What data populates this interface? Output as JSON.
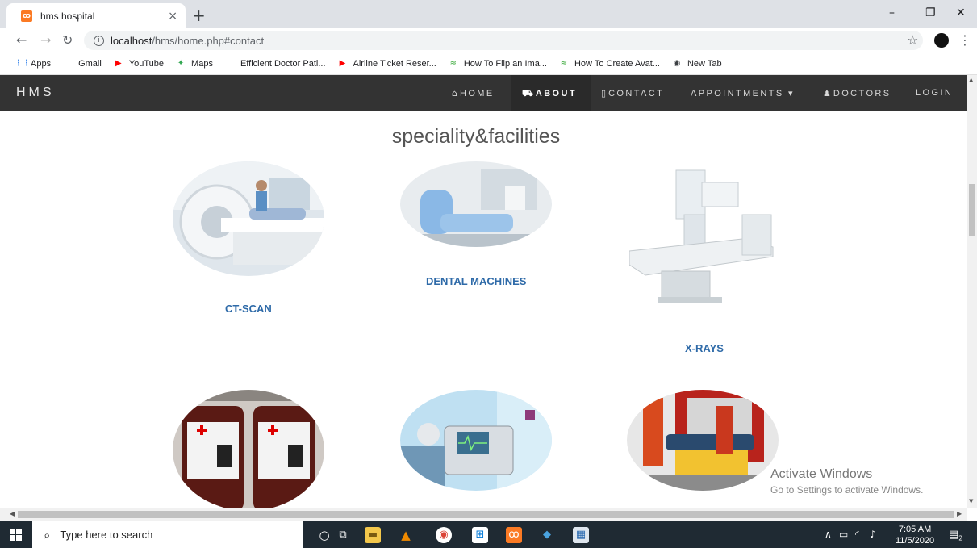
{
  "browser": {
    "tab_title": "hms hospital",
    "tab_close": "×",
    "new_tab": "+",
    "window_controls": {
      "minimize": "–",
      "maximize": "❐",
      "close": "✕"
    },
    "url_host": "localhost",
    "url_path": "/hms/home.php#contact",
    "bookmarks": [
      {
        "label": "Apps",
        "icon": "apps-grid-icon",
        "color": "#1a73e8",
        "glyph": "⋮⋮"
      },
      {
        "label": "Gmail",
        "icon": "gmail-icon",
        "color": "#ffffff",
        "glyph": "M"
      },
      {
        "label": "YouTube",
        "icon": "youtube-icon",
        "color": "#ff0000",
        "glyph": "▶"
      },
      {
        "label": "Maps",
        "icon": "maps-icon",
        "color": "#34a853",
        "glyph": "✦"
      },
      {
        "label": "Efficient Doctor Pati...",
        "icon": "sketch-icon",
        "color": "#ffffff",
        "glyph": "𝓋"
      },
      {
        "label": "Airline Ticket Reser...",
        "icon": "youtube-icon",
        "color": "#ff0000",
        "glyph": "▶"
      },
      {
        "label": "How To Flip an Ima...",
        "icon": "site-icon",
        "color": "#5cb85c",
        "glyph": "≈"
      },
      {
        "label": "How To Create Avat...",
        "icon": "site-icon",
        "color": "#5cb85c",
        "glyph": "≈"
      },
      {
        "label": "New Tab",
        "icon": "globe-icon",
        "color": "#3c4043",
        "glyph": "◉"
      }
    ]
  },
  "site": {
    "brand": "HMS",
    "nav": [
      {
        "label": "HOME",
        "glyph": "⌂",
        "icon": "home-icon"
      },
      {
        "label": "ABOUT",
        "glyph": "⛟",
        "icon": "cart-icon"
      },
      {
        "label": "CONTACT",
        "glyph": "▯",
        "icon": "phone-icon"
      },
      {
        "label": "APPOINTMENTS ▾",
        "glyph": "",
        "icon": ""
      },
      {
        "label": "DOCTORS",
        "glyph": "♟",
        "icon": "user-icon"
      },
      {
        "label": "LOGIN",
        "glyph": "",
        "icon": ""
      }
    ],
    "section_title": "speciality&facilities",
    "facilities": [
      {
        "label": "CT-SCAN"
      },
      {
        "label": "DENTAL MACHINES"
      },
      {
        "label": "X-RAYS"
      }
    ]
  },
  "watermark": {
    "line1": "Activate Windows",
    "line2": "Go to Settings to activate Windows."
  },
  "taskbar": {
    "search_placeholder": "Type here to search",
    "time": "7:05 AM",
    "date": "11/5/2020",
    "notification_count": "2"
  }
}
